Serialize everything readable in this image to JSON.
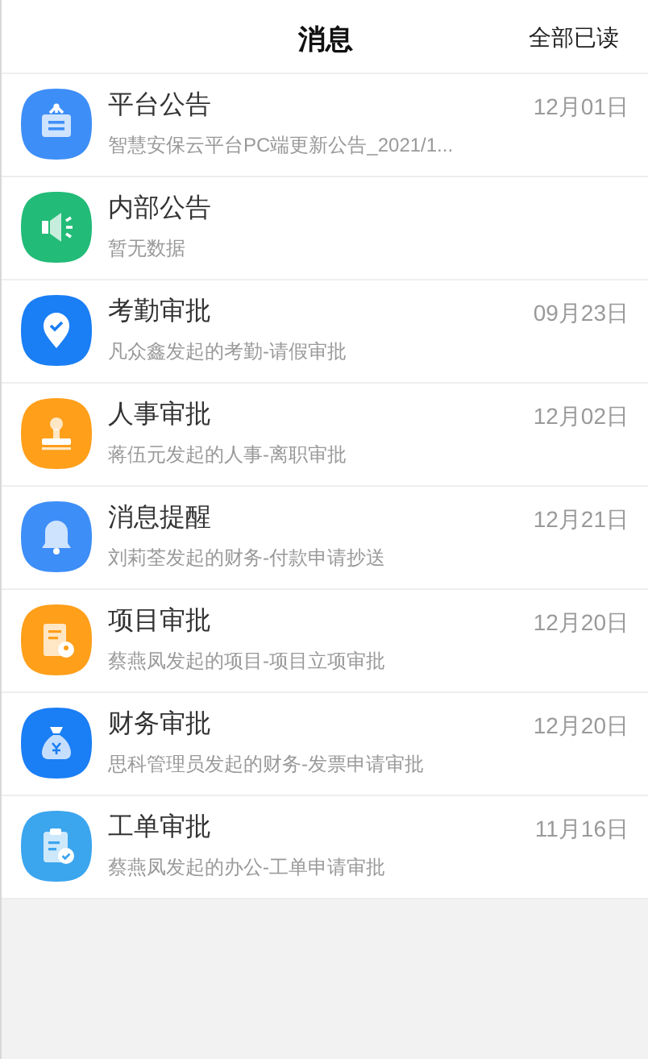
{
  "header": {
    "title": "消息",
    "action": "全部已读"
  },
  "messages": [
    {
      "kind": "notice-board",
      "color": "#3d8ef7",
      "title": "平台公告",
      "preview": "智慧安保云平台PC端更新公告_2021/1...",
      "date": "12月01日"
    },
    {
      "kind": "speaker",
      "color": "#22bb78",
      "title": "内部公告",
      "preview": "暂无数据"
    },
    {
      "kind": "location",
      "color": "#1a7ef5",
      "title": "考勤审批",
      "preview": "凡众鑫发起的考勤-请假审批",
      "date": "09月23日"
    },
    {
      "kind": "stamp",
      "color": "#ff9f1a",
      "title": "人事审批",
      "preview": "蒋伍元发起的人事-离职审批",
      "date": "12月02日"
    },
    {
      "kind": "bell",
      "color": "#3d8ef7",
      "title": "消息提醒",
      "preview": "刘莉荃发起的财务-付款申请抄送",
      "date": "12月21日"
    },
    {
      "kind": "document",
      "color": "#ff9f1a",
      "title": "项目审批",
      "preview": "蔡燕凤发起的项目-项目立项审批",
      "date": "12月20日"
    },
    {
      "kind": "money-bag",
      "color": "#1a7ef5",
      "title": "财务审批",
      "preview": "思科管理员发起的财务-发票申请审批",
      "date": "12月20日"
    },
    {
      "kind": "clipboard",
      "color": "#3ba5ee",
      "title": "工单审批",
      "preview": "蔡燕凤发起的办公-工单申请审批",
      "date": "11月16日"
    }
  ]
}
